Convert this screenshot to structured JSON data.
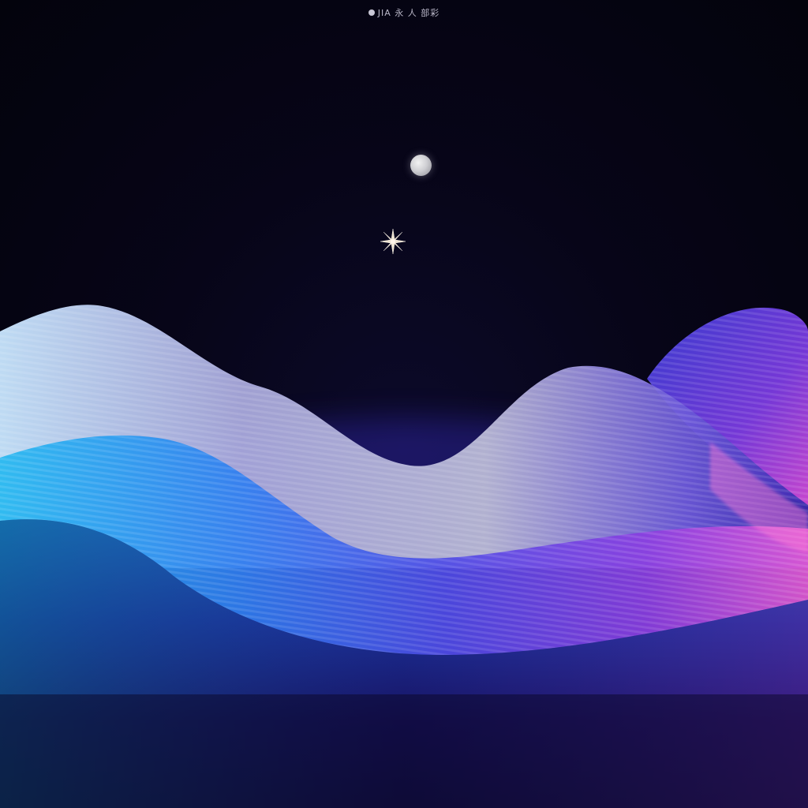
{
  "caption": {
    "text": "JIA 永 人 部彩",
    "icon": "circle-dot-icon"
  },
  "scene": {
    "sky_color": "#05040f",
    "moon_icon": "moon-icon",
    "star_icon": "sparkle-star-icon",
    "palette": {
      "cyan": "#25b8f0",
      "blue": "#3b4fe0",
      "violet": "#7a3ae0",
      "magenta": "#d04ad8",
      "silver": "#c9cbe0",
      "deep": "#120a4a"
    }
  }
}
